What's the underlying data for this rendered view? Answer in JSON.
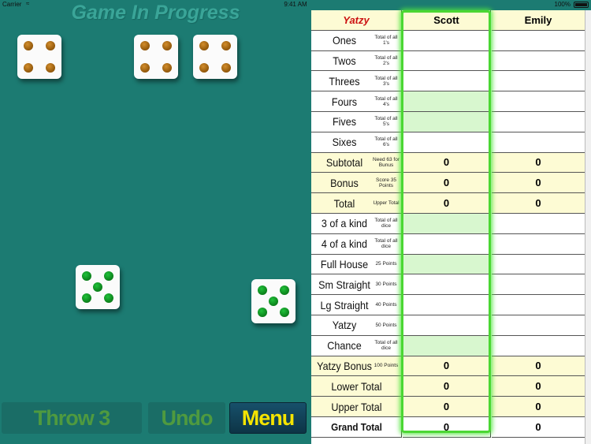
{
  "status_bar": {
    "carrier": "Carrier",
    "time": "9:41 AM",
    "battery": "100%"
  },
  "title": "Game In Progress",
  "dice": [
    {
      "value": 4,
      "state": "held",
      "pip_color": "#9a5f10"
    },
    {
      "value": 4,
      "state": "held",
      "pip_color": "#9a5f10"
    },
    {
      "value": 4,
      "state": "held",
      "pip_color": "#9a5f10"
    },
    {
      "value": 5,
      "state": "rolled",
      "pip_color": "#129a28"
    },
    {
      "value": 5,
      "state": "rolled",
      "pip_color": "#129a28"
    }
  ],
  "buttons": {
    "throw": "Throw 3",
    "undo": "Undo",
    "menu": "Menu"
  },
  "scorecard": {
    "title": "Yatzy",
    "players": [
      "Scott",
      "Emily"
    ],
    "rows": [
      {
        "name": "Ones",
        "hint": "Total of all 1's",
        "p1": "",
        "p2": "",
        "style": "white",
        "p1_possible": false
      },
      {
        "name": "Twos",
        "hint": "Total of all 2's",
        "p1": "",
        "p2": "",
        "style": "white",
        "p1_possible": false
      },
      {
        "name": "Threes",
        "hint": "Total of all 3's",
        "p1": "",
        "p2": "",
        "style": "white",
        "p1_possible": false
      },
      {
        "name": "Fours",
        "hint": "Total of all 4's",
        "p1": "",
        "p2": "",
        "style": "white",
        "p1_possible": true
      },
      {
        "name": "Fives",
        "hint": "Total of all 5's",
        "p1": "",
        "p2": "",
        "style": "white",
        "p1_possible": true
      },
      {
        "name": "Sixes",
        "hint": "Total of all 6's",
        "p1": "",
        "p2": "",
        "style": "white",
        "p1_possible": false
      },
      {
        "name": "Subtotal",
        "hint": "Need 63 for Bunus",
        "p1": "0",
        "p2": "0",
        "style": "yellow",
        "p1_possible": false
      },
      {
        "name": "Bonus",
        "hint": "Score 35 Points",
        "p1": "0",
        "p2": "0",
        "style": "yellow",
        "p1_possible": false
      },
      {
        "name": "Total",
        "hint": "Upper Total",
        "p1": "0",
        "p2": "0",
        "style": "yellow",
        "p1_possible": false
      },
      {
        "name": "3 of a kind",
        "hint": "Total of all dice",
        "p1": "",
        "p2": "",
        "style": "white",
        "p1_possible": true
      },
      {
        "name": "4 of a kind",
        "hint": "Total of all dice",
        "p1": "",
        "p2": "",
        "style": "white",
        "p1_possible": false
      },
      {
        "name": "Full House",
        "hint": "25 Points",
        "p1": "",
        "p2": "",
        "style": "white",
        "p1_possible": true
      },
      {
        "name": "Sm Straight",
        "hint": "30 Points",
        "p1": "",
        "p2": "",
        "style": "white",
        "p1_possible": false
      },
      {
        "name": "Lg Straight",
        "hint": "40 Points",
        "p1": "",
        "p2": "",
        "style": "white",
        "p1_possible": false
      },
      {
        "name": "Yatzy",
        "hint": "50 Points",
        "p1": "",
        "p2": "",
        "style": "white",
        "p1_possible": false
      },
      {
        "name": "Chance",
        "hint": "Total of all dice",
        "p1": "",
        "p2": "",
        "style": "white",
        "p1_possible": true
      },
      {
        "name": "Yatzy Bonus",
        "hint": "100 Points",
        "p1": "0",
        "p2": "0",
        "style": "yellow",
        "p1_possible": false
      },
      {
        "name": "Lower Total",
        "hint": "",
        "p1": "0",
        "p2": "0",
        "style": "yellow",
        "p1_possible": false
      },
      {
        "name": "Upper Total",
        "hint": "",
        "p1": "0",
        "p2": "0",
        "style": "yellow",
        "p1_possible": false
      },
      {
        "name": "Grand Total",
        "hint": "",
        "p1": "0",
        "p2": "0",
        "style": "white-bold",
        "p1_possible": false
      }
    ]
  }
}
